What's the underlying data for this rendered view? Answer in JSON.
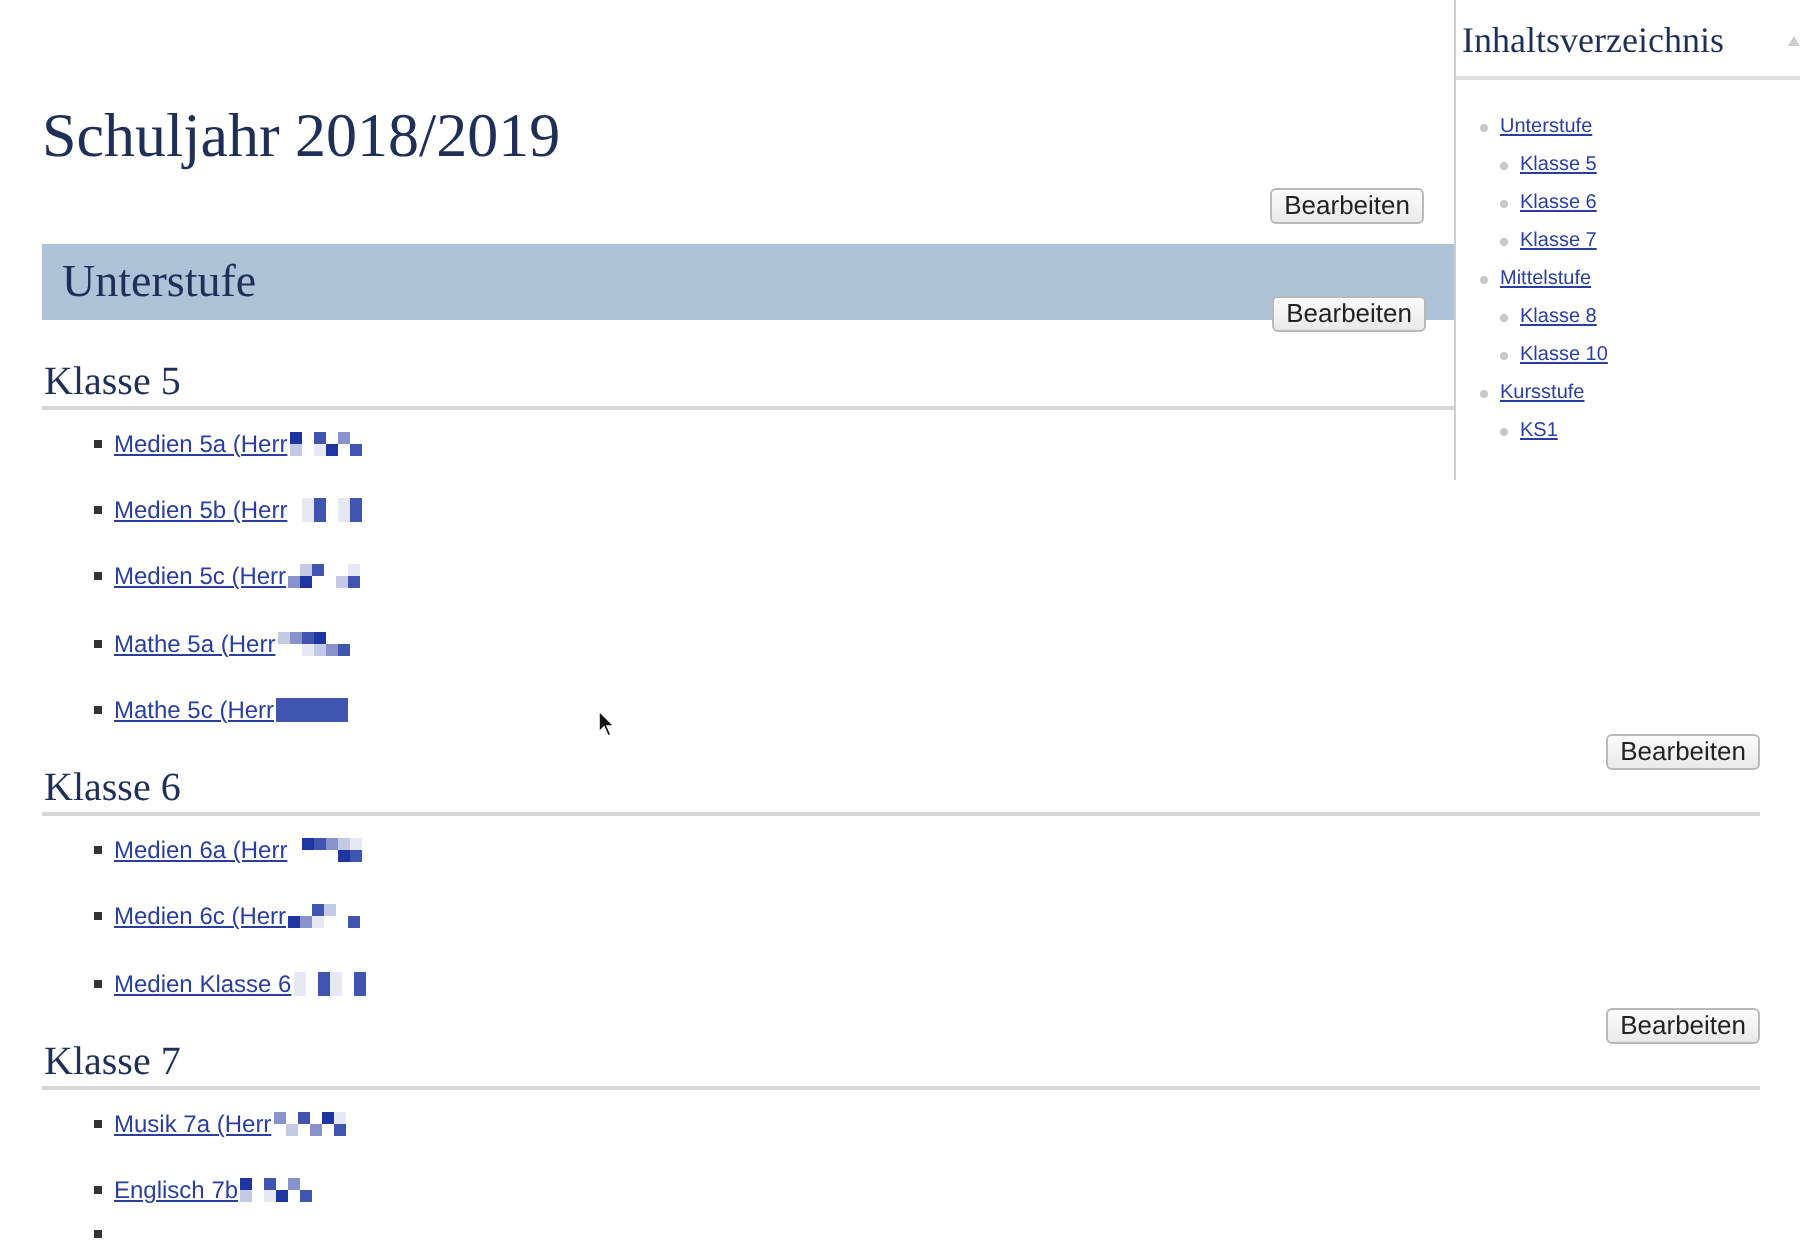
{
  "page": {
    "title": "Schuljahr 2018/2019",
    "edit_button": "Bearbeiten"
  },
  "sections": [
    {
      "title": "Unterstufe",
      "edit_button": "Bearbeiten",
      "classes": [
        {
          "title": "Klasse 5",
          "items": [
            {
              "kind": "link",
              "label": "Medien 5a (Herr",
              "redacted": true
            },
            {
              "kind": "link",
              "label": "Medien 5b (Herr",
              "redacted": true
            },
            {
              "kind": "link",
              "label": "Medien 5c (Herr",
              "redacted": true
            },
            {
              "kind": "link",
              "label": "Mathe 5a (Herr",
              "redacted": true
            },
            {
              "kind": "link",
              "label": "Mathe 5c (Herr",
              "redacted": true
            }
          ]
        },
        {
          "title": "Klasse 6",
          "edit_button": "Bearbeiten",
          "items": [
            {
              "kind": "link",
              "label": "Medien 6a (Herr",
              "redacted": true
            },
            {
              "kind": "link",
              "label": "Medien 6c (Herr",
              "redacted": true
            },
            {
              "kind": "link",
              "label": "Medien Klasse 6",
              "redacted": true
            }
          ]
        },
        {
          "title": "Klasse 7",
          "edit_button": "Bearbeiten",
          "items": [
            {
              "kind": "link",
              "label": "Musik 7a (Herr",
              "redacted": true
            },
            {
              "kind": "link",
              "label": "Englisch 7b",
              "redacted": true
            },
            {
              "kind": "blank"
            }
          ]
        }
      ]
    }
  ],
  "toc": {
    "title": "Inhaltsverzeichnis",
    "items": [
      {
        "label": "Unterstufe",
        "children": [
          {
            "label": "Klasse 5"
          },
          {
            "label": "Klasse 6"
          },
          {
            "label": "Klasse 7"
          }
        ]
      },
      {
        "label": "Mittelstufe",
        "children": [
          {
            "label": "Klasse 8"
          },
          {
            "label": "Klasse 10"
          }
        ]
      },
      {
        "label": "Kursstufe",
        "children": [
          {
            "label": "KS1"
          }
        ]
      }
    ]
  }
}
